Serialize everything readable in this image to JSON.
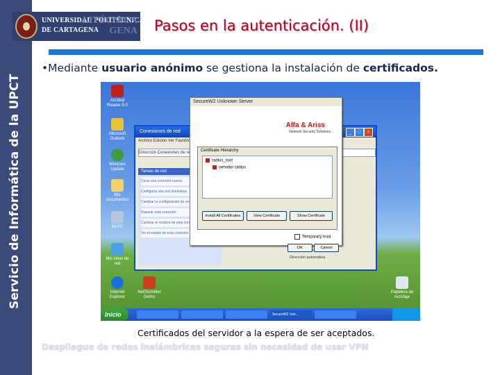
{
  "sidebar": {
    "text": "Servicio de Informática de la UPCT"
  },
  "logo": {
    "line1": "UNIVERSIDAD POLITÉCNICA",
    "line2": "DE CARTAGENA",
    "ghost1": "LITÉCNICA",
    "ghost2": "GENA"
  },
  "title": "Pasos en la autenticación. (II)",
  "bullet": {
    "marker": "•",
    "part1": "Mediante ",
    "bold1": "usuario anónimo",
    "part2": " se gestiona la instalación de ",
    "bold2": "certificados."
  },
  "screenshot": {
    "desktop_icons": [
      "Acrobat Reader 5.0",
      "Microsoft Outlook",
      "Windows Update",
      "Mis documentos",
      "Mi PC",
      "Mis sitios de red",
      "Internet Explorer",
      "NetStumbler Demo",
      "Papelera de reciclaje"
    ],
    "bg_window": {
      "title": "Conexiones de red",
      "menu": "Archivo  Edición  Ver  Favoritos",
      "address": "Dirección   Conexiones de red",
      "task_header": "Tareas de red",
      "task_items": [
        "Crear una conexión nueva",
        "Configurar una red doméstica",
        "Cambiar la configuración de red",
        "Reparar esta conexión",
        "Cambiar el nombre de esta conexión",
        "Ver el estado de esta conexión"
      ],
      "status1": "Conexión de red inalámbrica",
      "status2": "Dirección automática"
    },
    "main_dialog": {
      "title": "SecureW2 Unknown Server",
      "brand": "Alfa & Ariss",
      "brand_sub": "Network Security Solutions",
      "section": "Certificate Hierarchy",
      "tree_root": "radius_root",
      "tree_child": "servidor radius",
      "btn_install": "Install All Certificates",
      "btn_view": "View Certificate",
      "btn_show": "Show Certificate",
      "checkbox": "Temporary trust",
      "btn_ok": "OK",
      "btn_cancel": "Cancel"
    },
    "taskbar": {
      "start": "Inicio",
      "buttons": [
        "",
        "",
        "",
        "SecureW2 Unk...",
        ""
      ],
      "clock": ""
    }
  },
  "caption": "Certificados del servidor a la espera de ser aceptados.",
  "footer": "Despliegue de redes inalámbricas seguras sin necesidad de usar VPN",
  "colors": {
    "sidebar": "#3b4a78",
    "title": "#b3001e",
    "rule": "#1b78d6",
    "body_text": "#1b2555"
  }
}
